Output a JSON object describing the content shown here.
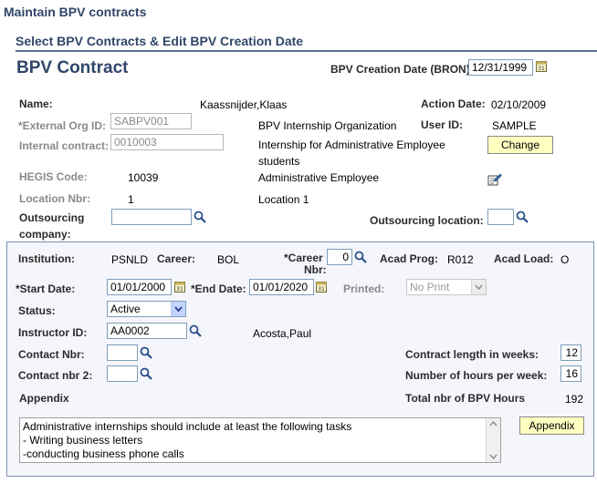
{
  "page_title": "Maintain BPV contracts",
  "section_title": "Select BPV Contracts & Edit BPV Creation Date",
  "header": {
    "title": "BPV Contract",
    "creation_date_label": "BPV Creation Date (BRON)",
    "creation_date_value": "12/31/1999"
  },
  "contract": {
    "name_label": "Name:",
    "name_value": "Kaassnijder,Klaas",
    "action_date_label": "Action Date:",
    "action_date_value": "02/10/2009",
    "ext_org_label": "*External Org ID:",
    "ext_org_value": "SABPV001",
    "ext_org_desc": "BPV Internship Organization",
    "user_id_label": "User ID:",
    "user_id_value": "SAMPLE",
    "internal_contract_label": "Internal contract:",
    "internal_contract_value": "0010003",
    "internal_contract_desc_1": "Internship for Administrative Employee",
    "internal_contract_desc_2": "students",
    "change_button": "Change",
    "hegis_label": "HEGIS Code:",
    "hegis_value": "10039",
    "hegis_desc": "Administrative Employee",
    "location_label": "Location Nbr:",
    "location_value": "1",
    "location_desc": "Location 1",
    "outsourcing_company_label_1": "Outsourcing",
    "outsourcing_company_label_2": "company:",
    "outsourcing_company_value": "",
    "outsourcing_location_label": "Outsourcing location:",
    "outsourcing_location_value": ""
  },
  "details": {
    "institution_label": "Institution:",
    "institution_value": "PSNLD",
    "career_label": "Career:",
    "career_value": "BOL",
    "career_nbr_label_1": "*Career",
    "career_nbr_label_2": "Nbr:",
    "career_nbr_value": "0",
    "acad_prog_label": "Acad Prog:",
    "acad_prog_value": "R012",
    "acad_load_label": "Acad Load:",
    "acad_load_value": "O",
    "start_date_label": "*Start Date:",
    "start_date_value": "01/01/2000",
    "end_date_label": "*End Date:",
    "end_date_value": "01/01/2020",
    "printed_label": "Printed:",
    "printed_value": "No Print",
    "status_label": "Status:",
    "status_value": "Active",
    "instructor_label": "Instructor ID:",
    "instructor_value": "AA0002",
    "instructor_name": "Acosta,Paul",
    "contact_nbr_label": "Contact Nbr:",
    "contact_nbr_value": "",
    "contact_nbr2_label": "Contact nbr 2:",
    "contact_nbr2_value": "",
    "contract_length_label": "Contract length in weeks:",
    "contract_length_value": "12",
    "hours_per_week_label": "Number of hours per week:",
    "hours_per_week_value": "16",
    "appendix_label": "Appendix",
    "total_hours_label": "Total nbr of BPV Hours",
    "total_hours_value": "192",
    "appendix_lines": [
      "Administrative internships should include at least the following tasks",
      "- Writing business letters",
      "-conducting business phone calls"
    ],
    "appendix_button": "Appendix"
  },
  "colors": {
    "title": "#31466a",
    "button_bg": "#ffffc0",
    "panel_bg": "#f4f6fb",
    "panel_border": "#7e8fb0"
  }
}
